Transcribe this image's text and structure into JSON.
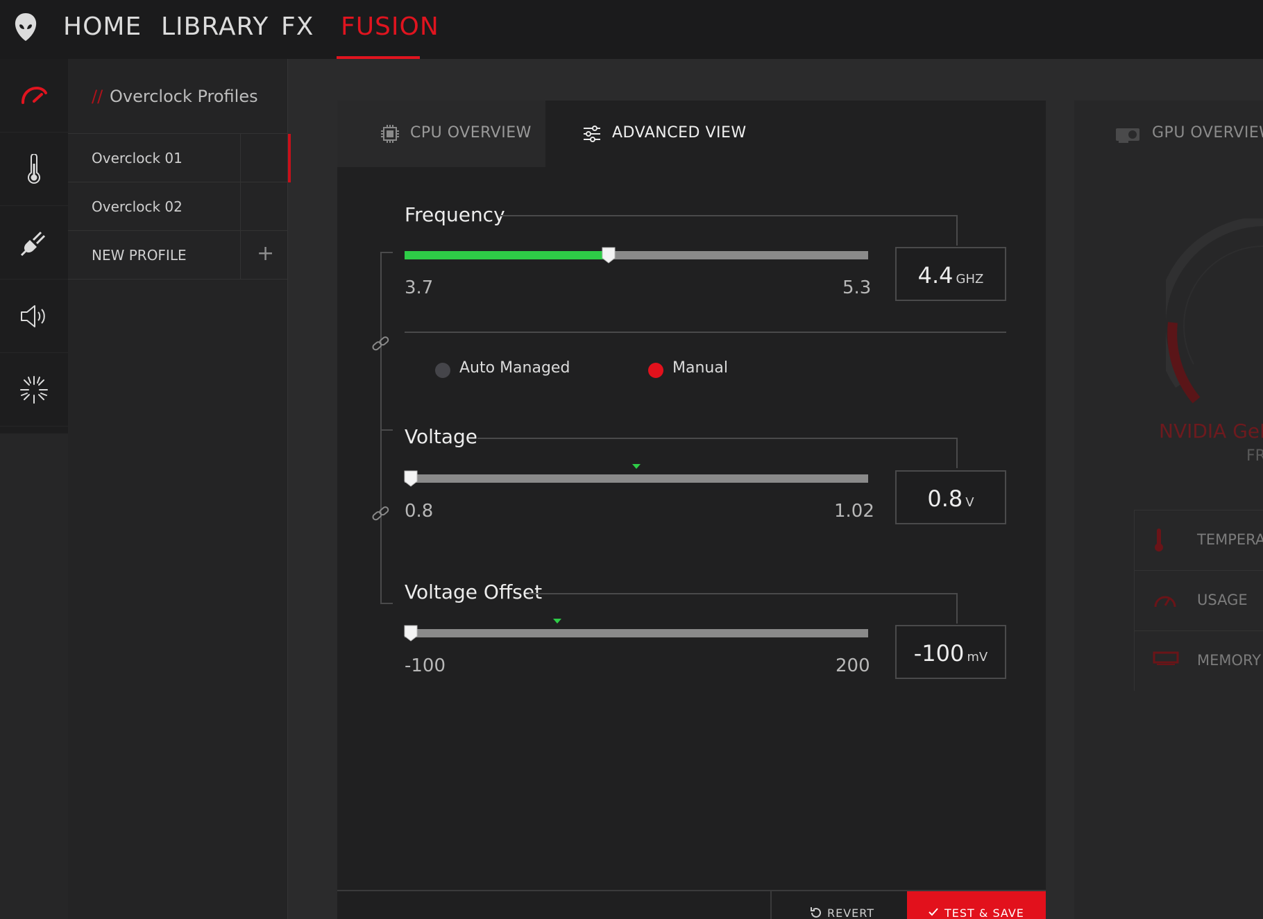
{
  "nav": {
    "items": [
      "HOME",
      "LIBRARY",
      "FX",
      "FUSION"
    ],
    "active": "FUSION",
    "accent": "#e0141f"
  },
  "icon_rail": [
    "performance-gauge-icon",
    "thermometer-icon",
    "power-plug-icon",
    "speaker-icon",
    "light-burst-icon"
  ],
  "profiles": {
    "prefix": "//",
    "title": "Overclock Profiles",
    "items": [
      "Overclock 01",
      "Overclock 02"
    ],
    "new_label": "NEW PROFILE",
    "add_symbol": "+",
    "active_index": 0
  },
  "tabs": {
    "cpu": "CPU OVERVIEW",
    "advanced": "ADVANCED VIEW",
    "gpu": "GPU OVERVIEW",
    "active": "ADVANCED VIEW"
  },
  "frequency": {
    "title": "Frequency",
    "min": "3.7",
    "max": "5.3",
    "value": "4.4",
    "unit": "GHZ",
    "fill_fraction": 0.44,
    "fill_color": "#2ecc47"
  },
  "mode": {
    "options": [
      "Auto Managed",
      "Manual"
    ],
    "selected": "Manual"
  },
  "voltage": {
    "title": "Voltage",
    "min": "0.8",
    "max": "1.02",
    "value": "0.8",
    "unit": "V",
    "thumb_fraction": 0.0,
    "marker_fraction": 0.5
  },
  "voltage_offset": {
    "title": "Voltage Offset",
    "min": "-100",
    "max": "200",
    "value": "-100",
    "unit": "mV",
    "thumb_fraction": 0.0,
    "marker_fraction": 0.33
  },
  "actions": {
    "revert": "REVERT",
    "save": "TEST & SAVE",
    "save_color": "#e2111c"
  },
  "gpu": {
    "name": "NVIDIA GeFor",
    "sub": "FR",
    "rows": [
      "TEMPERATU",
      "USAGE",
      "MEMORY (M"
    ]
  }
}
